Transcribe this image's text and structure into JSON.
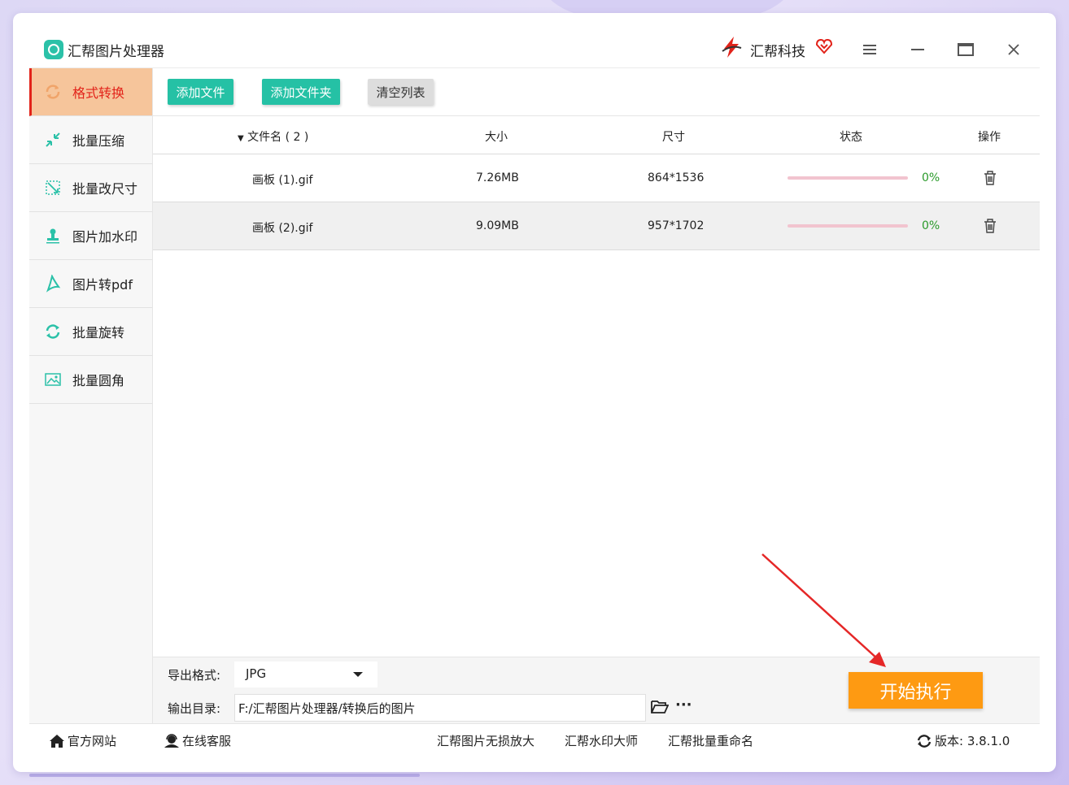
{
  "app": {
    "title": "汇帮图片处理器",
    "brand": "汇帮科技"
  },
  "window_controls": {
    "menu": "≡",
    "minimize": "—",
    "maximize": "▭",
    "close": "✕"
  },
  "sidebar": {
    "items": [
      {
        "label": "格式转换",
        "icon": "convert-icon",
        "active": true
      },
      {
        "label": "批量压缩",
        "icon": "compress-icon"
      },
      {
        "label": "批量改尺寸",
        "icon": "resize-icon"
      },
      {
        "label": "图片加水印",
        "icon": "watermark-icon"
      },
      {
        "label": "图片转pdf",
        "icon": "pdf-icon"
      },
      {
        "label": "批量旋转",
        "icon": "rotate-icon"
      },
      {
        "label": "批量圆角",
        "icon": "round-corner-icon"
      }
    ]
  },
  "toolbar": {
    "add_file": "添加文件",
    "add_folder": "添加文件夹",
    "clear_list": "清空列表"
  },
  "table": {
    "headers": {
      "filename": "文件名 ( 2 )",
      "size": "大小",
      "dimensions": "尺寸",
      "status": "状态",
      "actions": "操作"
    },
    "rows": [
      {
        "filename": "画板 (1).gif",
        "size": "7.26MB",
        "dimensions": "864*1536",
        "progress": 0,
        "status": "0%"
      },
      {
        "filename": "画板 (2).gif",
        "size": "9.09MB",
        "dimensions": "957*1702",
        "progress": 0,
        "status": "0%"
      }
    ]
  },
  "settings": {
    "format_label": "导出格式:",
    "format_value": "JPG",
    "dir_label": "输出目录:",
    "dir_value": "F:/汇帮图片处理器/转换后的图片",
    "more": "···",
    "start": "开始执行"
  },
  "footer": {
    "website": "官方网站",
    "support": "在线客服",
    "link1": "汇帮图片无损放大",
    "link2": "汇帮水印大师",
    "link3": "汇帮批量重命名",
    "version": "版本:  3.8.1.0"
  },
  "colors": {
    "accent_teal": "#25c1a5",
    "active_bg": "#f6c59b",
    "active_text": "#e2231a",
    "start_button": "#fe9a12",
    "status_green": "#2a9a2a"
  }
}
